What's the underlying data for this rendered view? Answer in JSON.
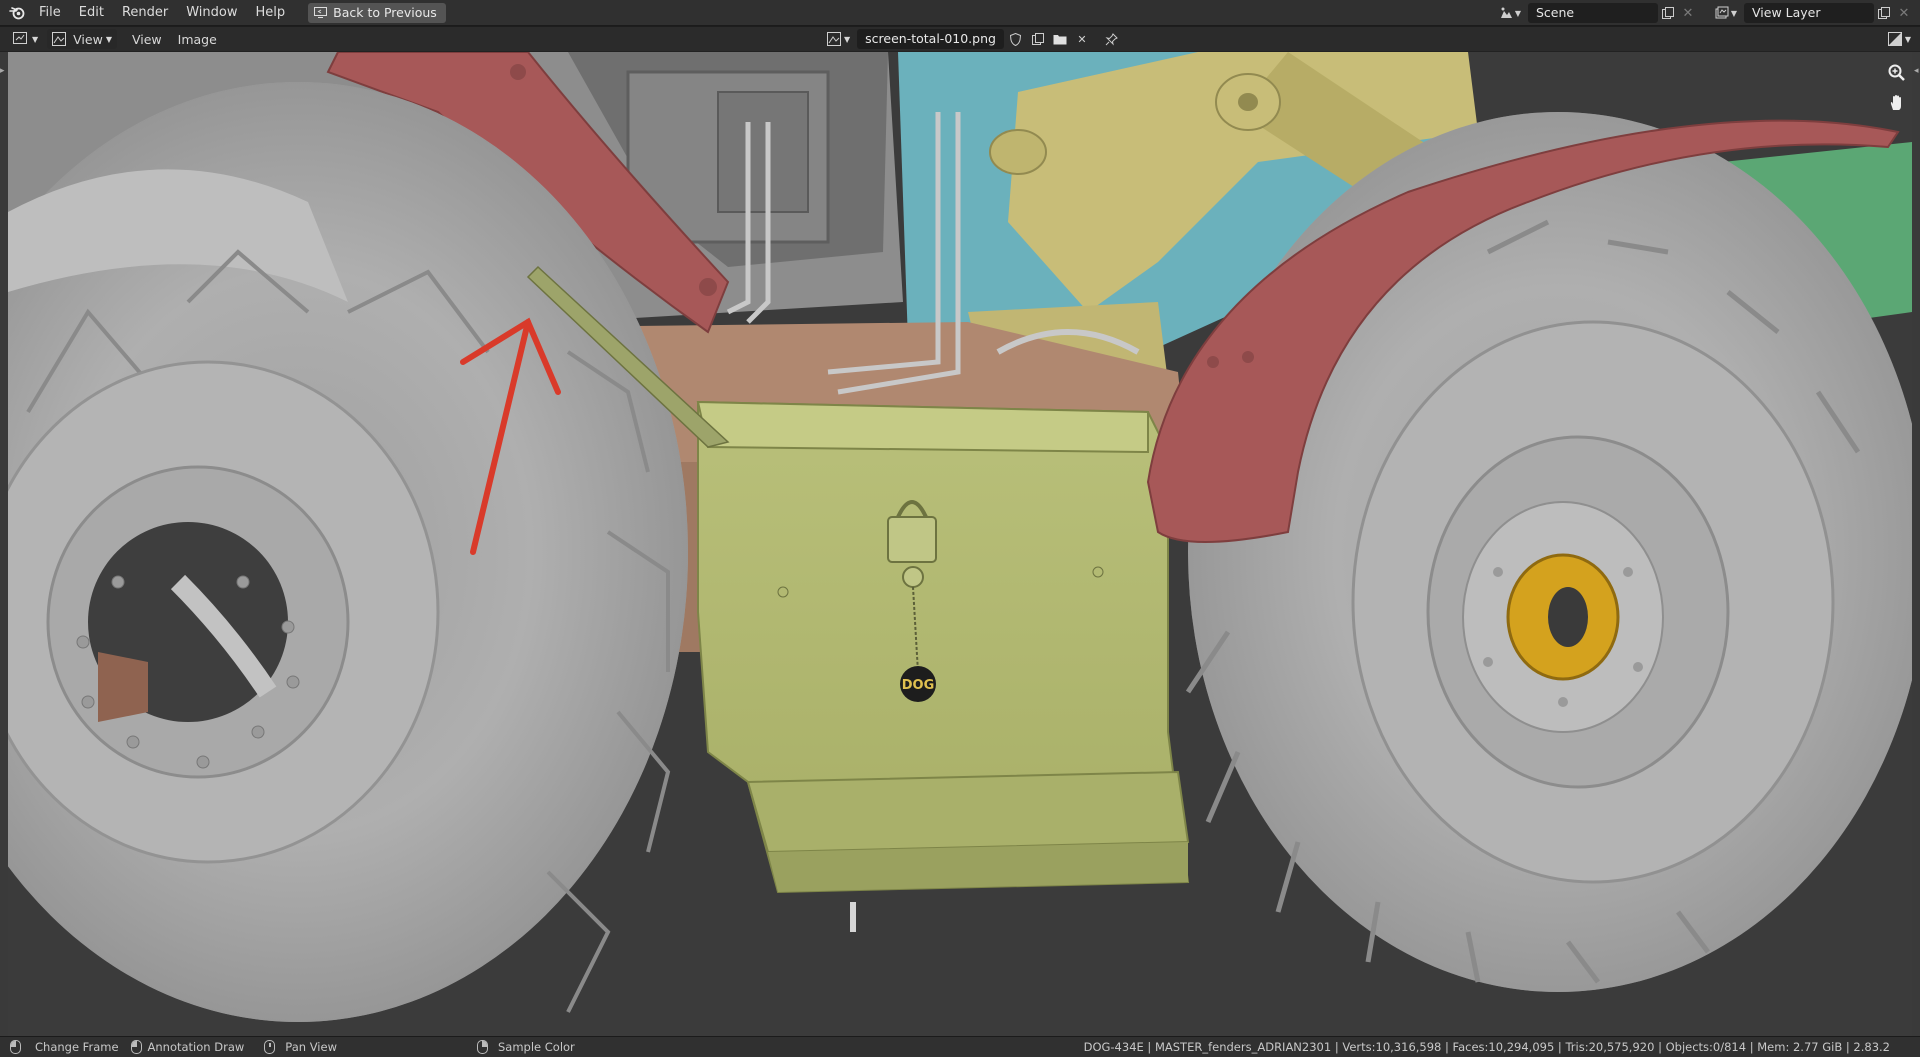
{
  "menu": {
    "items": [
      "File",
      "Edit",
      "Render",
      "Window",
      "Help"
    ],
    "back_button": "Back to Previous"
  },
  "topbar": {
    "scene_name": "Scene",
    "view_layer_name": "View Layer"
  },
  "editor_header": {
    "view_menu": "View",
    "view_label": "View",
    "image_label": "Image",
    "image_name": "screen-total-010.png"
  },
  "viewport": {
    "logo_text": "DOG"
  },
  "statusbar": {
    "change_frame": "Change Frame",
    "annotation_draw": "Annotation Draw",
    "pan_view": "Pan View",
    "sample_color": "Sample Color",
    "stats": "DOG-434E | MASTER_fenders_ADRIAN2301 | Verts:10,316,598 | Faces:10,294,095 | Tris:20,575,920 | Objects:0/814 | Mem: 2.77 GiB | 2.83.2"
  },
  "colors": {
    "tire": "#b8b8b8",
    "fender": "#a85a5a",
    "toolbox": "#b8bf74",
    "frame_yellow": "#c9be7a",
    "cabin_cyan": "#6fb4bf",
    "hub_gold": "#d8a420",
    "annotation": "#d93a2a",
    "background": "#3a3a3a"
  }
}
